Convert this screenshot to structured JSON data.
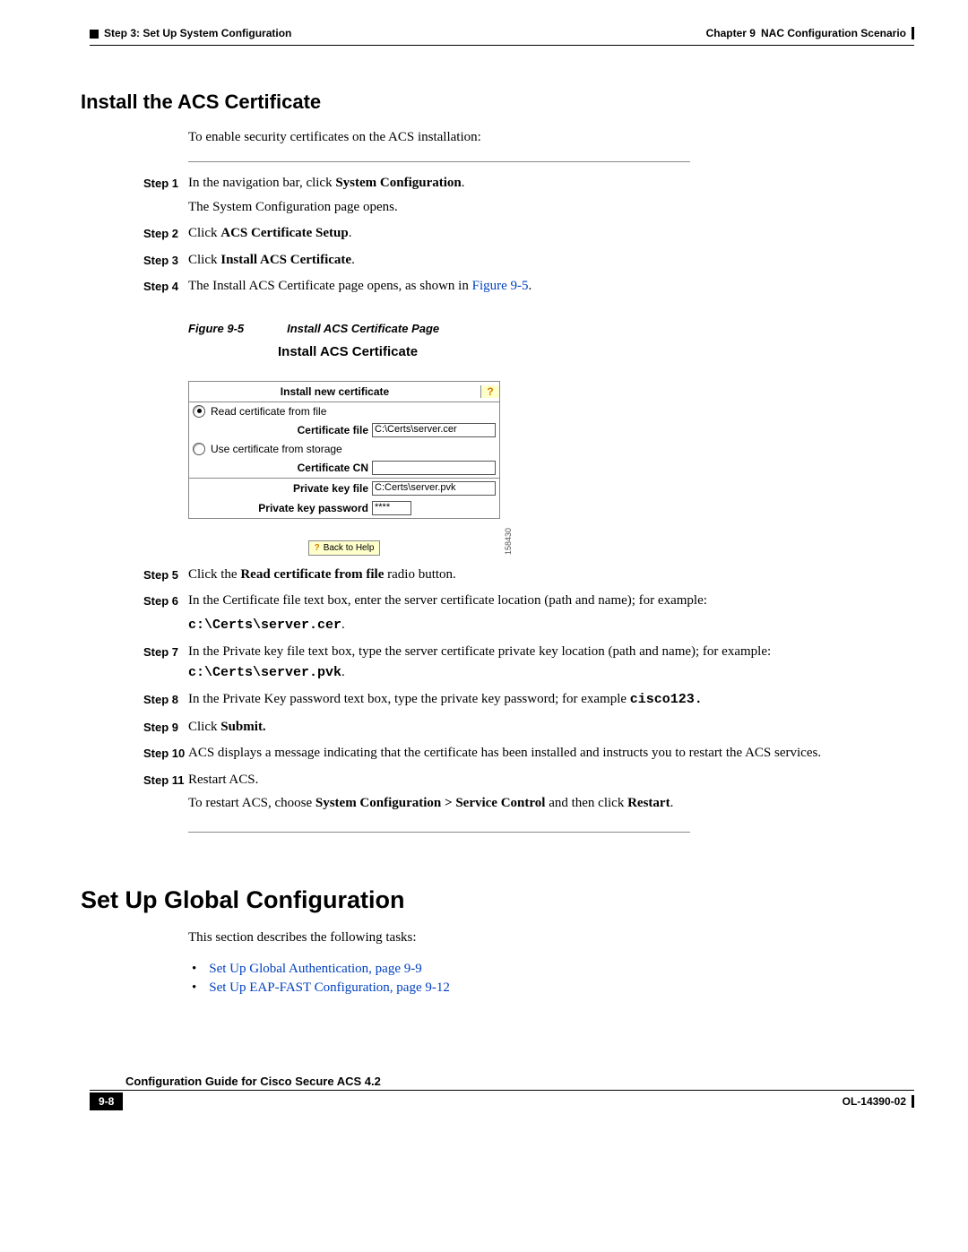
{
  "header": {
    "left": "Step 3: Set Up System Configuration",
    "right_chapter": "Chapter 9",
    "right_title": "NAC Configuration Scenario"
  },
  "h2": "Install the ACS Certificate",
  "intro": "To enable security certificates on the ACS installation:",
  "steps": {
    "s1": {
      "label": "Step 1",
      "line1a": "In the navigation bar, click ",
      "line1b": "System Configuration",
      "line1c": ".",
      "line2": "The System Configuration page opens."
    },
    "s2": {
      "label": "Step 2",
      "pre": "Click ",
      "bold": "ACS Certificate Setup",
      "post": "."
    },
    "s3": {
      "label": "Step 3",
      "pre": "Click ",
      "bold": "Install ACS Certificate",
      "post": "."
    },
    "s4": {
      "label": "Step 4",
      "pre": "The Install ACS Certificate page opens, as shown in ",
      "link": "Figure 9-5",
      "post": "."
    },
    "s5": {
      "label": "Step 5",
      "pre": "Click the ",
      "bold": "Read certificate from file",
      "post": " radio button."
    },
    "s6": {
      "label": "Step 6",
      "line1": "In the Certificate file text box, enter the server certificate location (path and name); for example:",
      "code": "c:\\Certs\\server.cer",
      "codepost": "."
    },
    "s7": {
      "label": "Step 7",
      "line1": "In the Private key file text box, type the server certificate private key location (path and name); for example: ",
      "code": "c:\\Certs\\server.pvk",
      "codepost": "."
    },
    "s8": {
      "label": "Step 8",
      "pre": "In the Private Key password text box, type the private key password; for example ",
      "code": "cisco123.",
      "post": ""
    },
    "s9": {
      "label": "Step 9",
      "pre": "Click ",
      "bold": "Submit.",
      "post": ""
    },
    "s10": {
      "label": "Step 10",
      "text": "ACS displays a message indicating that the certificate has been installed and instructs you to restart the ACS services."
    },
    "s11": {
      "label": "Step 11",
      "line1": "Restart ACS.",
      "line2a": "To restart ACS, choose ",
      "line2b": "System Configuration > Service Control",
      "line2c": " and then click ",
      "line2d": "Restart",
      "line2e": "."
    }
  },
  "figure": {
    "num": "Figure 9-5",
    "caption": "Install ACS Certificate Page",
    "title": "Install ACS Certificate",
    "panel_header": "Install new certificate",
    "opt1": "Read certificate from file",
    "certfile_lbl": "Certificate file",
    "certfile_val": "C:\\Certs\\server.cer",
    "opt2": "Use certificate from storage",
    "certcn_lbl": "Certificate CN",
    "certcn_val": "",
    "pkfile_lbl": "Private key file",
    "pkfile_val": "C:Certs\\server.pvk",
    "pkpass_lbl": "Private key password",
    "pkpass_val": "****",
    "back_to_help": "Back to Help",
    "sideno": "158430"
  },
  "h1": "Set Up Global Configuration",
  "global_intro": "This section describes the following tasks:",
  "links": {
    "l1": "Set Up Global Authentication, page 9-9",
    "l2": "Set Up EAP-FAST Configuration, page 9-12"
  },
  "footer": {
    "guide": "Configuration Guide for Cisco Secure ACS 4.2",
    "page": "9-8",
    "ol": "OL-14390-02"
  }
}
